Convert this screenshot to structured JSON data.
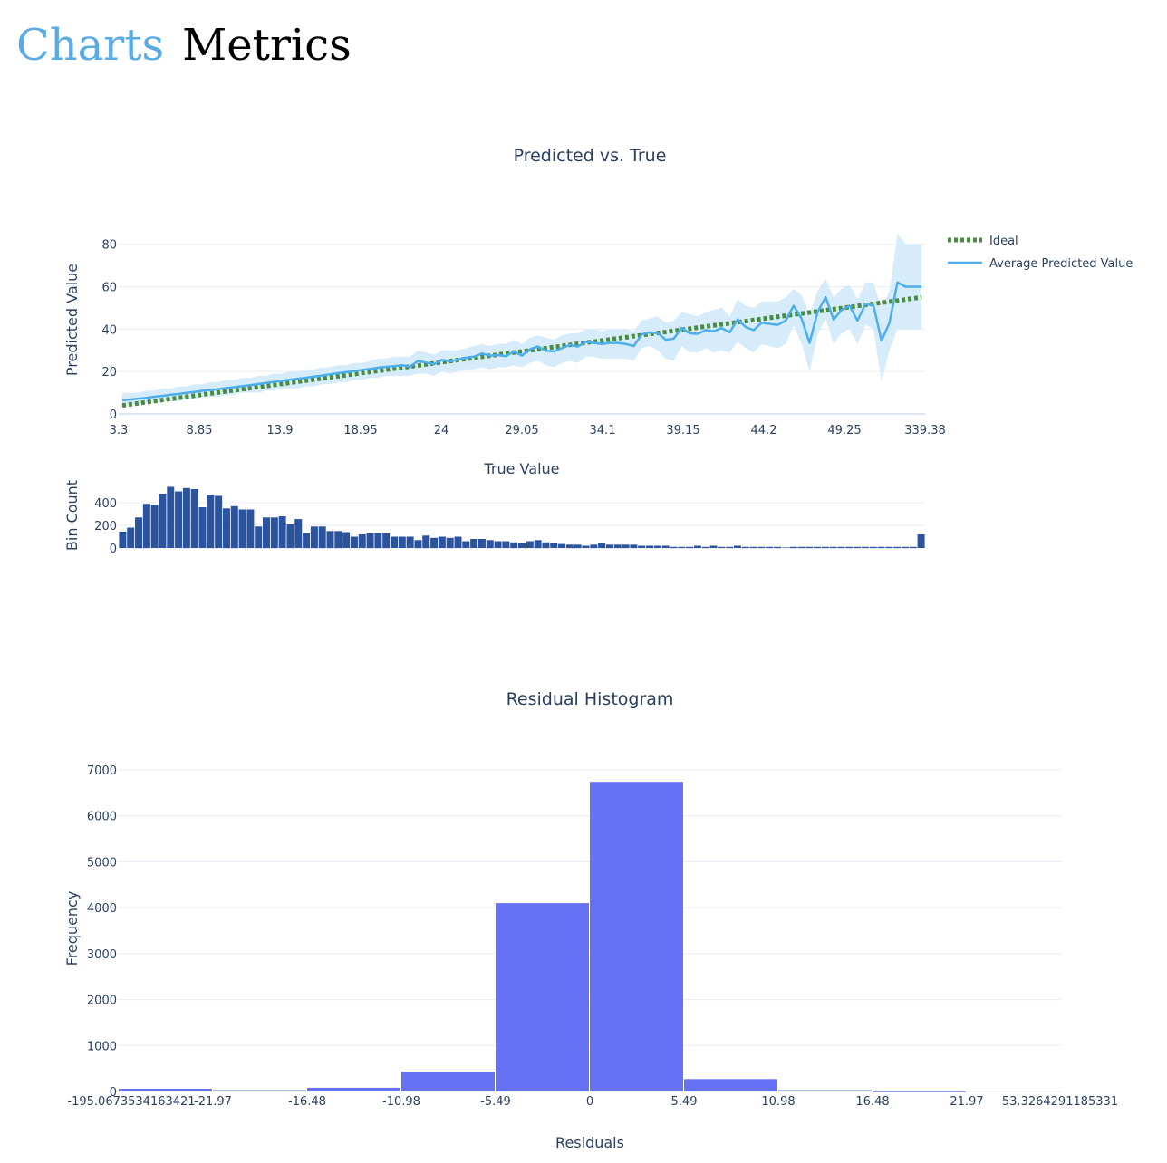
{
  "header": {
    "link_label": "Charts",
    "current_label": "Metrics"
  },
  "colors": {
    "ideal": "#4a8c3f",
    "avg_line": "#4daeec",
    "band": "#d6ecfb",
    "bin_bars": "#2c539e",
    "residual_bars": "#6771f3",
    "grid": "#e8ecf3",
    "text": "#2a3f5f"
  },
  "chart_data": [
    {
      "id": "pred_vs_true",
      "type": "line",
      "title": "Predicted vs. True",
      "xlabel": "True Value",
      "ylabel": "Predicted Value",
      "x_tick_labels": [
        "3.3",
        "8.85",
        "13.9",
        "18.95",
        "24",
        "29.05",
        "34.1",
        "39.15",
        "44.2",
        "49.25",
        "339.38"
      ],
      "ylim": [
        0,
        85
      ],
      "yticks": [
        0,
        20,
        40,
        60,
        80
      ],
      "legend": {
        "placement": "top-right",
        "entries": [
          "Ideal",
          "Average Predicted Value"
        ]
      },
      "x_index_range": [
        0,
        100
      ],
      "series": [
        {
          "name": "Ideal",
          "style": "dotted",
          "x": [
            0,
            100
          ],
          "y": [
            4,
            55
          ]
        },
        {
          "name": "Average Predicted Value",
          "style": "line",
          "x": [
            0,
            1,
            2,
            3,
            4,
            5,
            6,
            7,
            8,
            9,
            10,
            11,
            12,
            13,
            14,
            15,
            16,
            17,
            18,
            19,
            20,
            21,
            22,
            23,
            24,
            25,
            26,
            27,
            28,
            29,
            30,
            31,
            32,
            33,
            34,
            35,
            36,
            37,
            38,
            39,
            40,
            41,
            42,
            43,
            44,
            45,
            46,
            47,
            48,
            49,
            50,
            51,
            52,
            53,
            54,
            55,
            56,
            57,
            58,
            59,
            60,
            61,
            62,
            63,
            64,
            65,
            66,
            67,
            68,
            69,
            70,
            71,
            72,
            73,
            74,
            75,
            76,
            77,
            78,
            79,
            80,
            81,
            82,
            83,
            84,
            85,
            86,
            87,
            88,
            89,
            90,
            91,
            92,
            93,
            94,
            95,
            96,
            97,
            98,
            99,
            100
          ],
          "y": [
            6.5,
            6.8,
            7.2,
            7.6,
            8.1,
            8.5,
            9.0,
            9.4,
            9.9,
            10.4,
            10.9,
            11.3,
            11.7,
            12.2,
            12.6,
            13.1,
            13.6,
            14.1,
            14.6,
            15.1,
            15.6,
            16.2,
            16.6,
            17.1,
            17.6,
            18.1,
            18.7,
            19.2,
            19.7,
            20.2,
            20.7,
            21.2,
            21.8,
            22.2,
            22.5,
            23.0,
            22.2,
            25.0,
            24.2,
            23.5,
            25.5,
            24.8,
            25.6,
            26.5,
            27.0,
            28.5,
            27.5,
            27.8,
            27.2,
            29.5,
            27.5,
            30.5,
            31.8,
            29.8,
            29.5,
            31.0,
            32.5,
            31.8,
            34.0,
            33.5,
            33.0,
            33.5,
            33.5,
            33.0,
            32.0,
            37.5,
            38.5,
            38.2,
            35.0,
            35.5,
            40.5,
            38.0,
            37.8,
            39.5,
            39.0,
            40.5,
            38.5,
            44.5,
            41.0,
            39.5,
            43.0,
            42.5,
            42.0,
            44.0,
            51.0,
            45.0,
            33.5,
            48.0,
            55.0,
            44.5,
            49.0,
            51.0,
            44.0,
            52.0,
            51.0,
            34.5,
            43.0,
            62.0,
            60.0,
            60.0,
            60.0
          ],
          "upper": [
            10,
            10,
            10,
            11,
            11,
            12,
            12,
            13,
            13,
            14,
            14,
            15,
            15,
            16,
            16,
            17,
            17,
            18,
            18,
            19,
            19,
            20,
            20,
            21,
            21,
            22,
            22,
            23,
            23,
            24,
            24,
            25,
            26,
            26,
            27,
            27,
            27,
            30,
            29,
            28,
            30,
            30,
            30,
            31,
            32,
            33,
            32,
            33,
            33,
            35,
            33,
            36,
            37,
            36,
            35,
            37,
            38,
            38,
            40,
            40,
            39,
            40,
            40,
            40,
            39,
            44,
            45,
            46,
            43,
            44,
            48,
            47,
            46,
            48,
            49,
            50,
            46,
            54,
            51,
            50,
            53,
            53,
            53,
            55,
            59,
            56,
            47,
            58,
            64,
            55,
            59,
            61,
            54,
            62,
            62,
            50,
            58,
            85,
            80,
            80,
            80
          ],
          "lower": [
            4,
            4,
            5,
            5,
            5,
            6,
            6,
            6,
            7,
            7,
            8,
            8,
            8,
            9,
            9,
            10,
            10,
            10,
            11,
            11,
            12,
            12,
            12,
            13,
            13,
            14,
            14,
            15,
            15,
            16,
            16,
            17,
            17,
            18,
            18,
            18,
            18,
            19,
            19,
            18,
            20,
            19,
            20,
            21,
            21,
            22,
            21,
            22,
            22,
            23,
            22,
            24,
            25,
            23,
            22,
            24,
            25,
            24,
            27,
            27,
            26,
            26,
            26,
            26,
            25,
            31,
            32,
            30,
            26,
            25,
            32,
            29,
            29,
            31,
            29,
            30,
            29,
            34,
            31,
            29,
            33,
            32,
            31,
            33,
            42,
            33,
            20,
            37,
            45,
            33,
            38,
            40,
            33,
            42,
            40,
            15,
            30,
            40,
            40,
            40,
            40
          ]
        }
      ]
    },
    {
      "id": "bin_counts",
      "type": "bar",
      "xlabel": "",
      "ylabel": "Bin Count",
      "ylim": [
        0,
        520
      ],
      "yticks": [
        0,
        200,
        400
      ],
      "values": [
        145,
        180,
        270,
        390,
        380,
        480,
        540,
        500,
        530,
        520,
        360,
        470,
        460,
        350,
        370,
        340,
        340,
        190,
        270,
        270,
        280,
        210,
        255,
        130,
        190,
        190,
        150,
        150,
        140,
        100,
        120,
        130,
        130,
        130,
        100,
        100,
        100,
        70,
        110,
        90,
        100,
        90,
        100,
        60,
        80,
        80,
        70,
        60,
        60,
        50,
        40,
        60,
        70,
        50,
        40,
        35,
        30,
        30,
        20,
        30,
        40,
        30,
        30,
        30,
        30,
        20,
        20,
        20,
        20,
        10,
        10,
        10,
        20,
        10,
        20,
        10,
        10,
        20,
        10,
        10,
        10,
        10,
        10,
        5,
        10,
        10,
        10,
        10,
        10,
        10,
        10,
        10,
        10,
        10,
        10,
        10,
        10,
        10,
        10,
        10,
        120
      ]
    },
    {
      "id": "residual_hist",
      "type": "bar",
      "title": "Residual Histogram",
      "xlabel": "Residuals",
      "ylabel": "Frequency",
      "ylim": [
        0,
        7000
      ],
      "yticks": [
        0,
        1000,
        2000,
        3000,
        4000,
        5000,
        6000,
        7000
      ],
      "bin_edges": [
        "-195.0673534163421",
        "-21.97",
        "-16.48",
        "-10.98",
        "-5.49",
        "0",
        "5.49",
        "10.98",
        "16.48",
        "21.97",
        "53.3264291185331"
      ],
      "values": [
        60,
        30,
        80,
        430,
        4100,
        6740,
        270,
        30,
        5,
        0
      ]
    }
  ]
}
